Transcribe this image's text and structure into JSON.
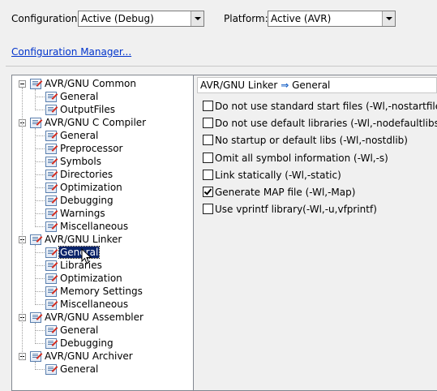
{
  "config": {
    "configuration_label": "Configuration:",
    "configuration_value": "Active (Debug)",
    "platform_label": "Platform:",
    "platform_value": "Active (AVR)",
    "config_manager_link": "Configuration Manager..."
  },
  "tree": {
    "groups": [
      {
        "label": "AVR/GNU Common",
        "children": [
          "General",
          "OutputFiles"
        ]
      },
      {
        "label": "AVR/GNU C Compiler",
        "children": [
          "General",
          "Preprocessor",
          "Symbols",
          "Directories",
          "Optimization",
          "Debugging",
          "Warnings",
          "Miscellaneous"
        ]
      },
      {
        "label": "AVR/GNU Linker",
        "children": [
          "General",
          "Libraries",
          "Optimization",
          "Memory Settings",
          "Miscellaneous"
        ]
      },
      {
        "label": "AVR/GNU Assembler",
        "children": [
          "General",
          "Debugging"
        ]
      },
      {
        "label": "AVR/GNU Archiver",
        "children": [
          "General"
        ]
      }
    ],
    "selected": "AVR/GNU Linker > General"
  },
  "panel": {
    "breadcrumb_parent": "AVR/GNU Linker",
    "breadcrumb_arrow": "⇒",
    "breadcrumb_child": "General",
    "options": [
      {
        "label": "Do not use standard start files (-Wl,-nostartfiles)",
        "checked": false
      },
      {
        "label": "Do not use default libraries (-Wl,-nodefaultlibs)",
        "checked": false
      },
      {
        "label": "No startup or default libs (-Wl,-nostdlib)",
        "checked": false
      },
      {
        "label": "Omit all symbol information (-Wl,-s)",
        "checked": false
      },
      {
        "label": "Link statically (-Wl,-static)",
        "checked": false
      },
      {
        "label": "Generate MAP file (-Wl,-Map)",
        "checked": true
      },
      {
        "label": "Use vprintf library(-Wl,-u,vfprintf)",
        "checked": false
      }
    ]
  }
}
